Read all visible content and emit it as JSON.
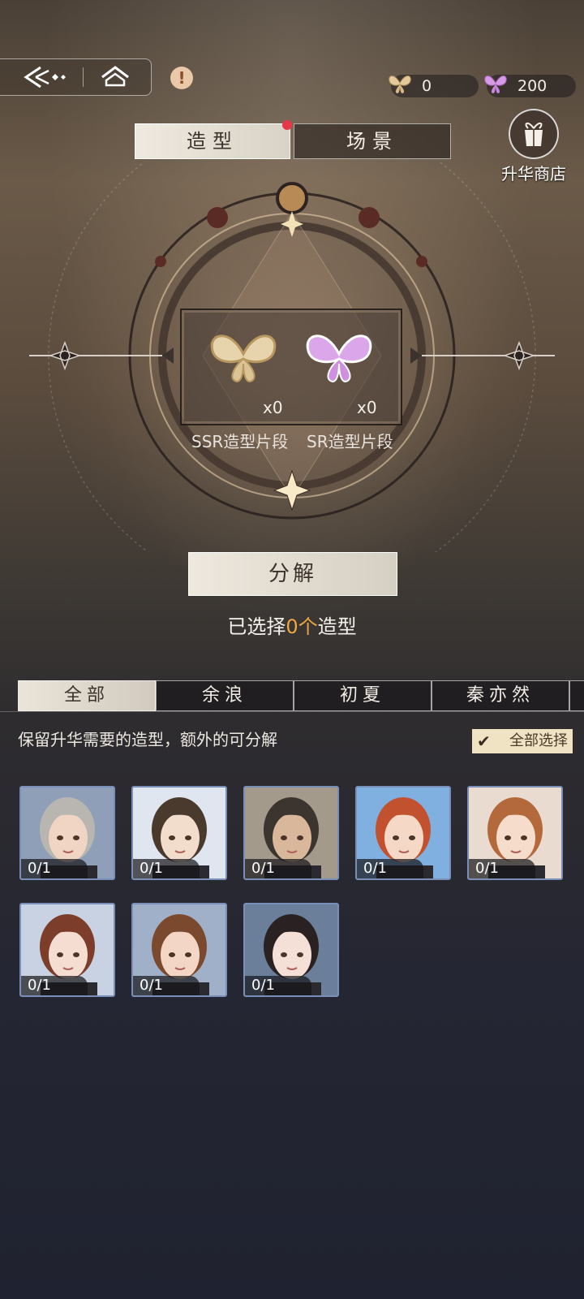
{
  "topbar": {
    "alert_symbol": "!",
    "currencies": [
      {
        "name": "ssr-fragment",
        "value": "0",
        "color": "#e5c99a"
      },
      {
        "name": "sr-fragment",
        "value": "200",
        "color": "#d79ae6"
      }
    ]
  },
  "tabs": {
    "style": "造型",
    "scene": "场景"
  },
  "shop": {
    "label": "升华商店"
  },
  "fragments": [
    {
      "label": "SSR造型片段",
      "count": "x0"
    },
    {
      "label": "SR造型片段",
      "count": "x0"
    }
  ],
  "decompose_label": "分解",
  "selected": {
    "prefix": "已选择",
    "count": "0个",
    "suffix": "造型"
  },
  "filter_tabs": [
    "全部",
    "余浪",
    "初夏",
    "秦亦然"
  ],
  "hint": "保留升华需要的造型，额外的可分解",
  "select_all": "全部选择",
  "cards": [
    {
      "count": "0/1",
      "hair": "#b9b6b2",
      "skin": "#f0d5c4",
      "bg": "#8f9fb8"
    },
    {
      "count": "0/1",
      "hair": "#4a3a2e",
      "skin": "#f2dccb",
      "bg": "#dfe6f0"
    },
    {
      "count": "0/1",
      "hair": "#3b342f",
      "skin": "#d9b79a",
      "bg": "#a39a8c"
    },
    {
      "count": "0/1",
      "hair": "#c2522f",
      "skin": "#f5d8c6",
      "bg": "#7fb0e0"
    },
    {
      "count": "0/1",
      "hair": "#b4693d",
      "skin": "#f5dccb",
      "bg": "#eadbd0"
    },
    {
      "count": "0/1",
      "hair": "#7c3d2a",
      "skin": "#f5ddd2",
      "bg": "#c9d2e2"
    },
    {
      "count": "0/1",
      "hair": "#7b4a2e",
      "skin": "#f3d6c6",
      "bg": "#9fb0c8"
    },
    {
      "count": "0/1",
      "hair": "#2a2222",
      "skin": "#f5e0d8",
      "bg": "#6c7f9a"
    }
  ],
  "colors": {
    "accent": "#f0a542",
    "badge": "#e8374a"
  }
}
